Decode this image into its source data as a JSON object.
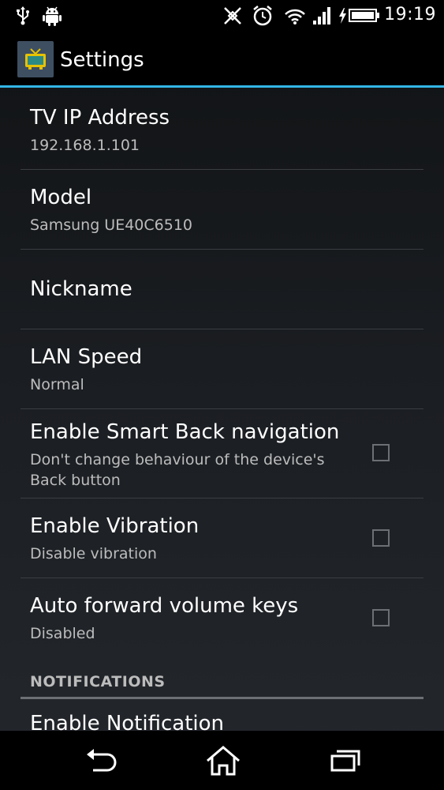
{
  "status_bar": {
    "time": "19:19",
    "icons": [
      "usb-icon",
      "android-debug-icon",
      "nfc-off-icon",
      "alarm-icon",
      "wifi-icon",
      "signal-icon",
      "battery-charging-icon"
    ]
  },
  "action_bar": {
    "title": "Settings",
    "app_icon": "tv-icon"
  },
  "preferences": [
    {
      "title": "TV IP Address",
      "summary": "192.168.1.101"
    },
    {
      "title": "Model",
      "summary": "Samsung UE40C6510"
    },
    {
      "title": "Nickname"
    },
    {
      "title": "LAN Speed",
      "summary": "Normal"
    },
    {
      "title": "Enable Smart Back navigation",
      "summary_line1": "Don't change behaviour of the device's",
      "summary_line2": "Back button",
      "checked": false
    },
    {
      "title": "Enable Vibration",
      "summary": "Disable vibration",
      "checked": false
    },
    {
      "title": "Auto forward volume keys",
      "summary": "Disabled",
      "checked": false
    }
  ],
  "category": {
    "label": "NOTIFICATIONS"
  },
  "partial_item": {
    "title": "Enable Notification"
  },
  "nav_bar": {
    "buttons": [
      "back-icon",
      "home-icon",
      "recent-apps-icon"
    ]
  },
  "colors": {
    "accent": "#33b5e5",
    "text_primary": "#ffffff",
    "text_secondary": "#bcbcbc"
  }
}
